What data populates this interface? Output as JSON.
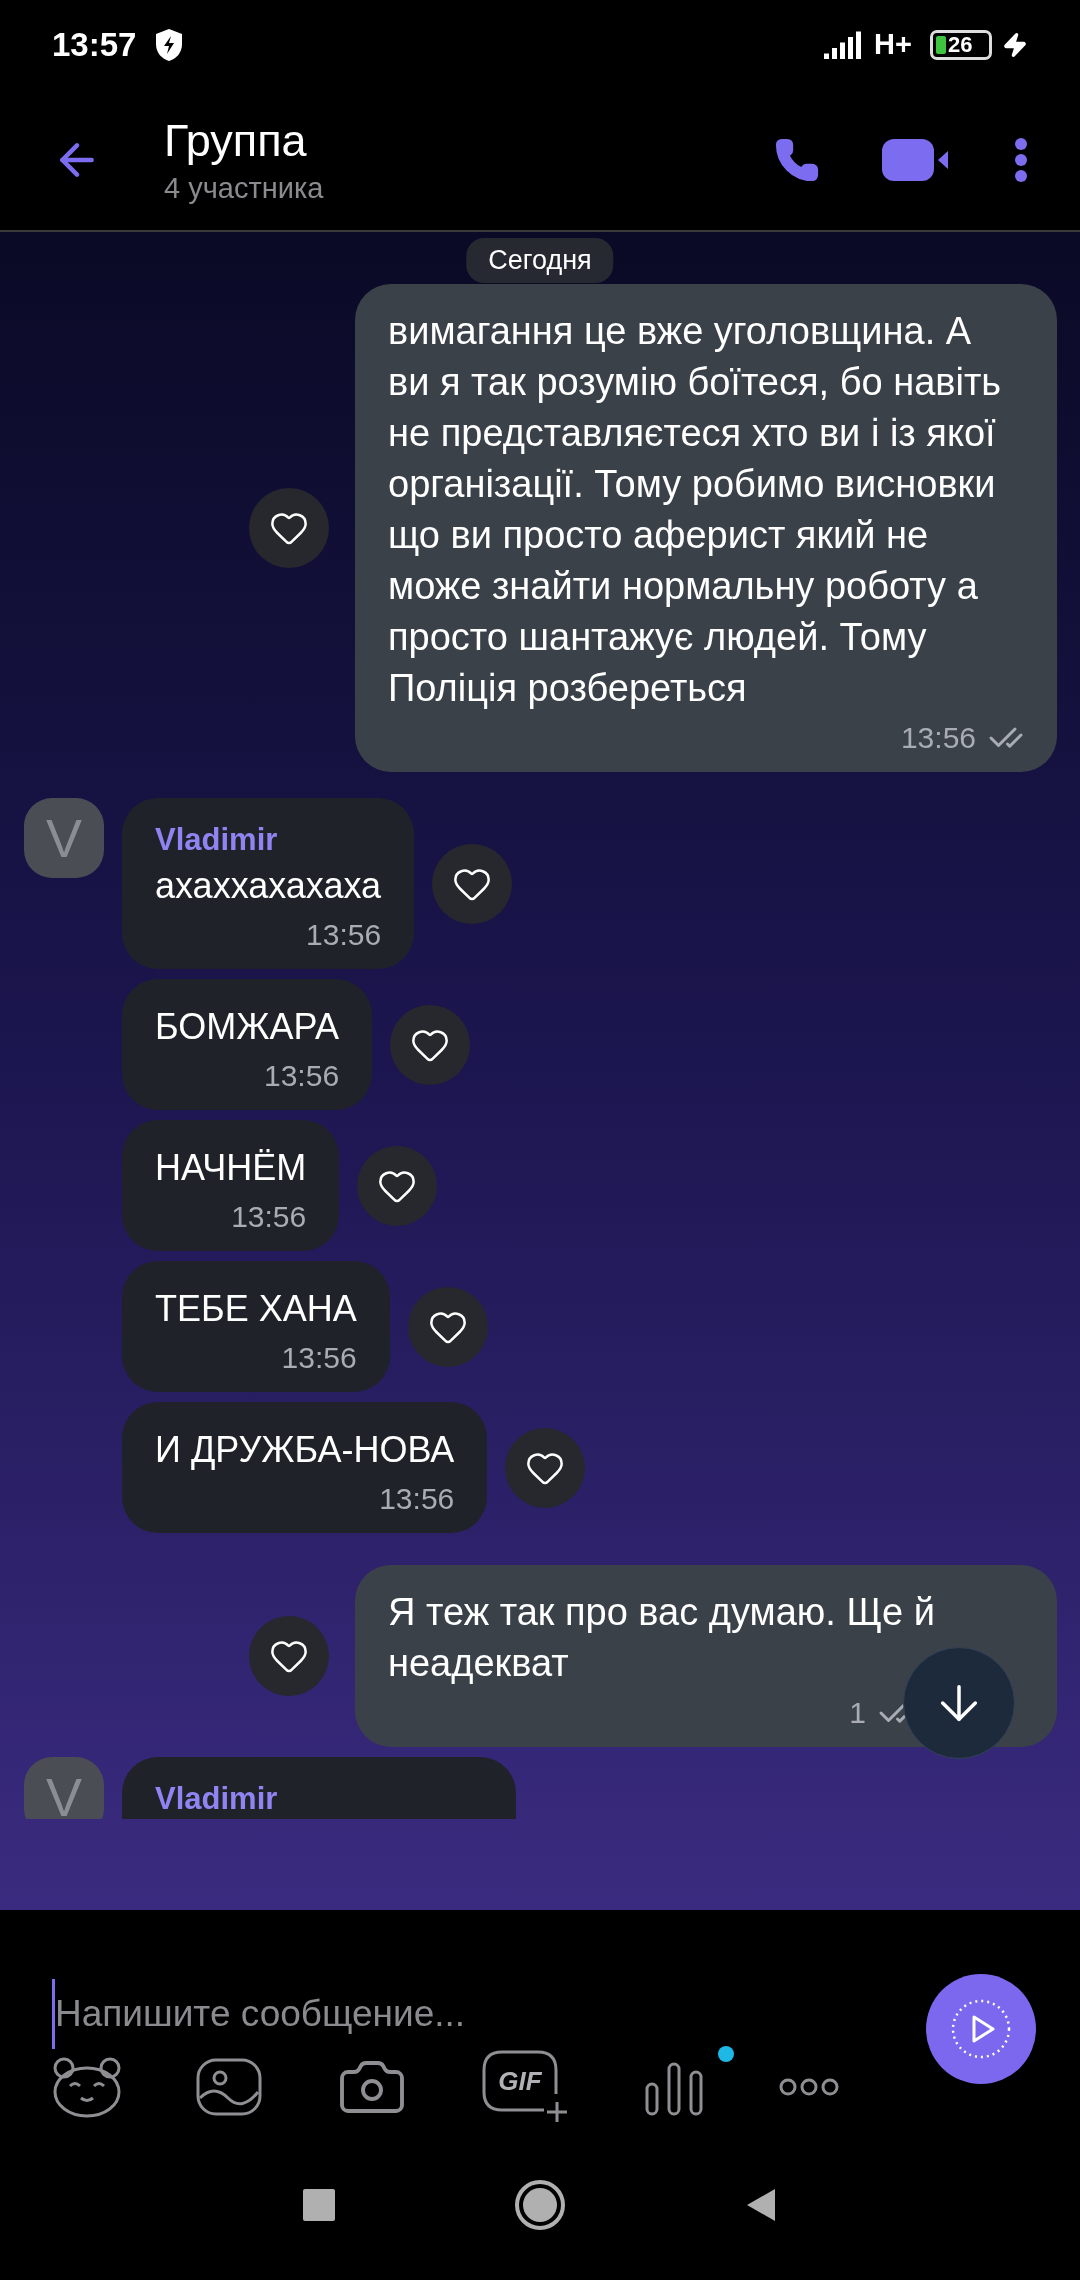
{
  "status_bar": {
    "time": "13:57",
    "network": "H+",
    "battery": "26"
  },
  "header": {
    "title": "Группа",
    "subtitle": "4 участника"
  },
  "date_chip": "Сегодня",
  "messages": [
    {
      "kind": "outgoing",
      "text": "вимагання це вже уголовщина. А ви я так розумію боїтеся, бо навіть не представляєтеся хто ви і із якої організації. Тому робимо висновки що ви просто аферист який не може знайти нормальну роботу а просто шантажує людей. Тому Поліція розбереться",
      "time": "13:56",
      "read": true,
      "liked": false
    },
    {
      "kind": "incoming",
      "sender": "Vladimir",
      "avatar_letter": "V",
      "text": "ахаххахахаха",
      "time": "13:56",
      "liked": false
    },
    {
      "kind": "incoming",
      "text": "БОМЖАРА",
      "time": "13:56",
      "liked": false
    },
    {
      "kind": "incoming",
      "text": "НАЧНЁМ",
      "time": "13:56",
      "liked": false
    },
    {
      "kind": "incoming",
      "text": "ТЕБЕ ХАНА",
      "time": "13:56",
      "liked": false
    },
    {
      "kind": "incoming",
      "text": "И ДРУЖБА-НОВА",
      "time": "13:56",
      "liked": false
    },
    {
      "kind": "outgoing",
      "text": "Я теж так про вас думаю. Ще й неадекват",
      "time": "1",
      "read": true,
      "liked": false,
      "scroll_button": true
    },
    {
      "kind": "incoming",
      "sender": "Vladimir",
      "avatar_letter": "V"
    }
  ],
  "composer": {
    "placeholder": "Напишите сообщение...",
    "gif_label": "GIF",
    "voice_notification": true
  }
}
